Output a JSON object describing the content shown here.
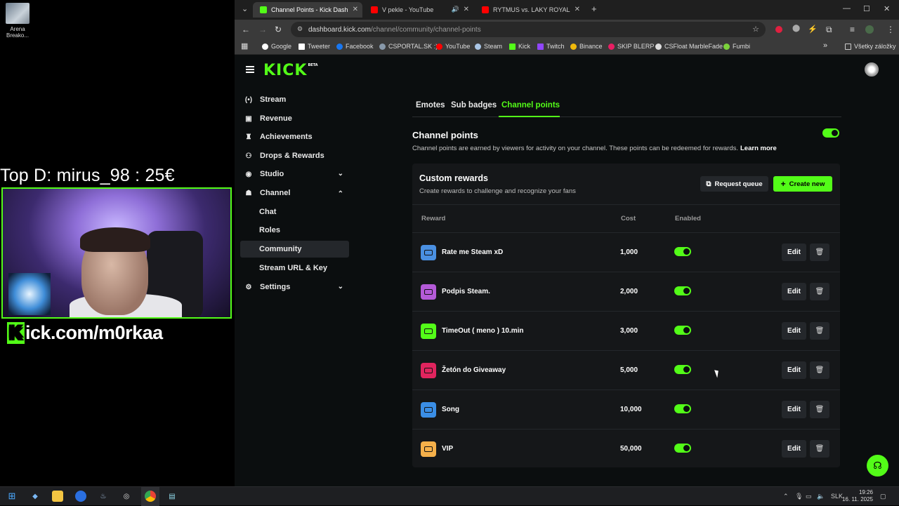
{
  "desktop": {
    "icon_label": "Arena Breako...",
    "overlay_text": "Top D: mirus_98 : 25€",
    "watermark_k": "K",
    "watermark_rest": "ick.com/m0rkaa"
  },
  "browser": {
    "tabs": [
      {
        "label": "Channel Points - Kick Dashboard",
        "color": "#53fc18"
      },
      {
        "label": "V pekle - YouTube",
        "color": "#ff0000"
      },
      {
        "label": "RYTMUS vs. LAKY ROYAL na DE",
        "color": "#ff0000"
      }
    ],
    "url_domain": "dashboard.kick.com",
    "url_path": "/channel/community/channel-points",
    "bookmarks": [
      {
        "label": "Google",
        "color": "#ffffff"
      },
      {
        "label": "Tweeter",
        "color": "#ffffff"
      },
      {
        "label": "Facebook",
        "color": "#1877f2"
      },
      {
        "label": "CSPORTAL.SK :)",
        "color": "#8899aa"
      },
      {
        "label": "YouTube",
        "color": "#ff0000"
      },
      {
        "label": "Steam",
        "color": "#aac6e6"
      },
      {
        "label": "Kick",
        "color": "#53fc18"
      },
      {
        "label": "Twitch",
        "color": "#9146ff"
      },
      {
        "label": "Binance",
        "color": "#f0b90b"
      },
      {
        "label": "SKIP BLERP",
        "color": "#e91e63"
      },
      {
        "label": "CSFloat MarbleFade",
        "color": "#dddddd"
      },
      {
        "label": "Fumbi",
        "color": "#7bd23b"
      }
    ],
    "all_bookmarks": "Všetky záložky"
  },
  "app": {
    "logo": "KICK",
    "logo_badge": "BETA",
    "accent_color": "#53fc18",
    "sidebar": {
      "items": [
        {
          "label": "Stream",
          "icon": "broadcast-icon"
        },
        {
          "label": "Revenue",
          "icon": "wallet-icon"
        },
        {
          "label": "Achievements",
          "icon": "trophy-icon"
        },
        {
          "label": "Drops & Rewards",
          "icon": "drops-icon"
        },
        {
          "label": "Studio",
          "icon": "studio-icon"
        },
        {
          "label": "Channel",
          "icon": "channel-icon"
        },
        {
          "label": "Settings",
          "icon": "gear-icon"
        }
      ],
      "channel_sub": [
        "Chat",
        "Roles",
        "Community",
        "Stream URL & Key"
      ]
    },
    "tabs": [
      "Emotes",
      "Sub badges",
      "Channel points"
    ],
    "channel_points": {
      "title": "Channel points",
      "description": "Channel points are earned by viewers for activity on your channel. These points can be redeemed for rewards.",
      "learn_more": "Learn more",
      "enabled": true
    },
    "custom_rewards": {
      "title": "Custom rewards",
      "subtitle": "Create rewards to challenge and recognize your fans",
      "request_queue": "Request queue",
      "create_new": "Create new",
      "columns": {
        "reward": "Reward",
        "cost": "Cost",
        "enabled": "Enabled"
      },
      "edit_label": "Edit",
      "rows": [
        {
          "name": "Rate me Steam xD",
          "cost": "1,000",
          "color": "#4a90e2",
          "enabled": true
        },
        {
          "name": "Podpis Steam.",
          "cost": "2,000",
          "color": "#b45ad8",
          "enabled": true
        },
        {
          "name": "TimeOut ( meno ) 10.min",
          "cost": "3,000",
          "color": "#53fc18",
          "enabled": true
        },
        {
          "name": "Žetón do Giveaway",
          "cost": "5,000",
          "color": "#e0245e",
          "enabled": true
        },
        {
          "name": "Song",
          "cost": "10,000",
          "color": "#3a8ee6",
          "enabled": true
        },
        {
          "name": "VIP",
          "cost": "50,000",
          "color": "#f5b04a",
          "enabled": true
        }
      ]
    }
  },
  "taskbar": {
    "language": "SLK",
    "time": "19:26",
    "date": "16. 11. 2025"
  }
}
